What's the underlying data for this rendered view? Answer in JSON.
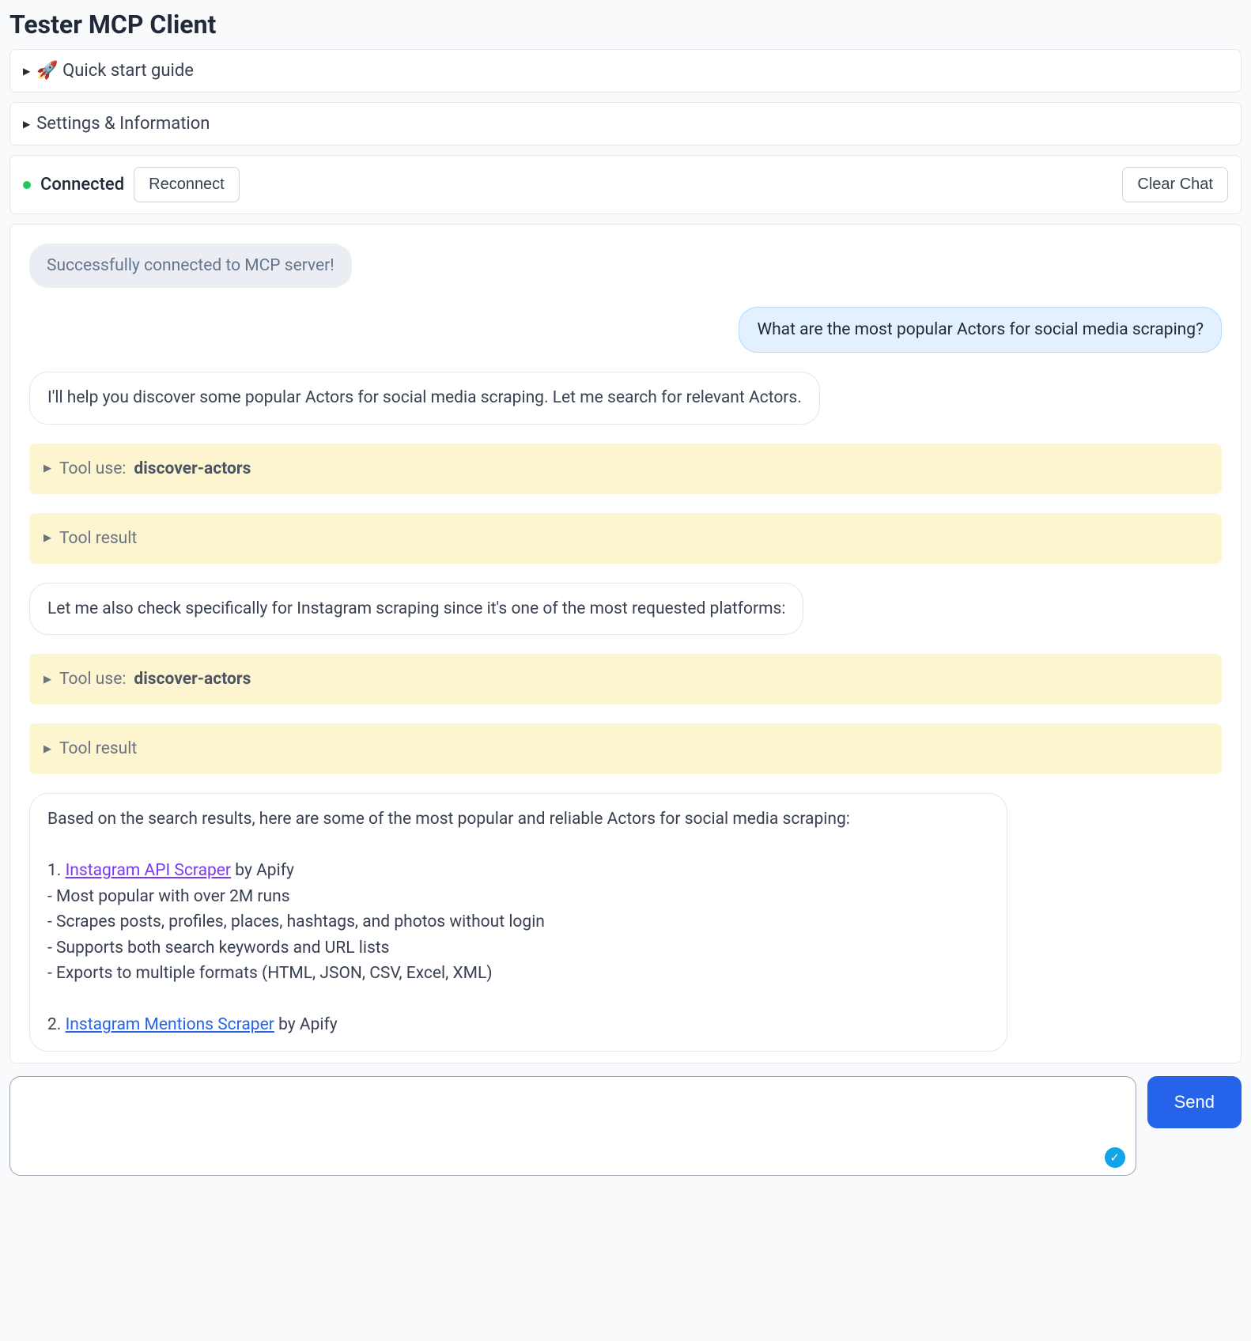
{
  "header": {
    "title": "Tester MCP Client"
  },
  "quick_start": {
    "label": "🚀 Quick start guide"
  },
  "settings": {
    "label": "Settings & Information"
  },
  "status": {
    "text": "Connected",
    "reconnect_label": "Reconnect",
    "clear_label": "Clear Chat"
  },
  "chat": {
    "system_msg": "Successfully connected to MCP server!",
    "user_msg": "What are the most popular Actors for social media scraping?",
    "assistant_msg_1": "I'll help you discover some popular Actors for social media scraping. Let me search for relevant Actors.",
    "tool_use_prefix": "Tool use: ",
    "tool_use_name_1": "discover-actors",
    "tool_result_label": "Tool result",
    "assistant_msg_2": "Let me also check specifically for Instagram scraping since it's one of the most requested platforms:",
    "tool_use_name_2": "discover-actors",
    "assistant_final": {
      "intro": "Based on the search results, here are some of the most popular and reliable Actors for social media scraping:",
      "item1_num": "1. ",
      "item1_link": "Instagram API Scraper",
      "item1_by": " by Apify",
      "item1_b1": "- Most popular with over 2M runs",
      "item1_b2": "- Scrapes posts, profiles, places, hashtags, and photos without login",
      "item1_b3": "- Supports both search keywords and URL lists",
      "item1_b4": "- Exports to multiple formats (HTML, JSON, CSV, Excel, XML)",
      "item2_num": "2. ",
      "item2_link": "Instagram Mentions Scraper",
      "item2_by": " by Apify"
    }
  },
  "input": {
    "placeholder": "",
    "send_label": "Send"
  }
}
